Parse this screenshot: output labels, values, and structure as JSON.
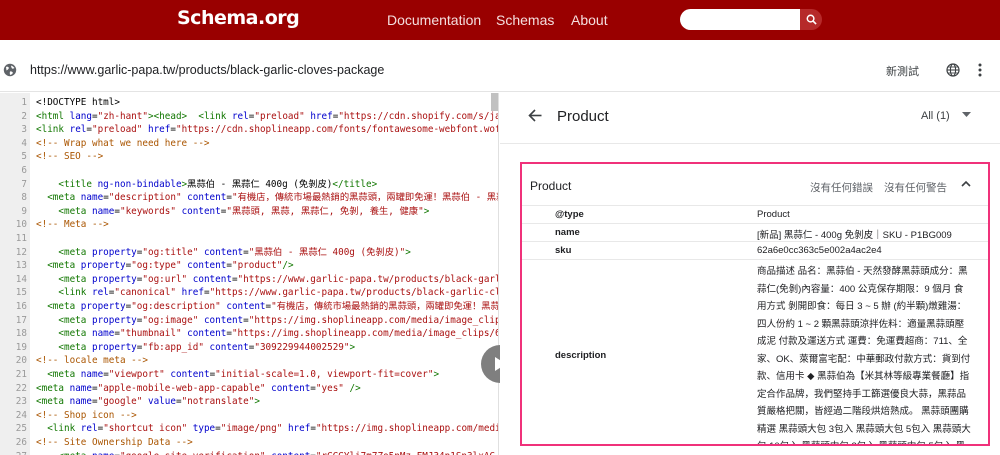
{
  "header": {
    "logo": "Schema.org",
    "nav": [
      "Documentation",
      "Schemas",
      "About"
    ],
    "search_placeholder": ""
  },
  "urlbar": {
    "url": "https://www.garlic-papa.tw/products/black-garlic-cloves-package",
    "new_test": "新測試"
  },
  "code": {
    "lines": [
      {
        "n": "1",
        "parts": [
          [
            "txt",
            "<!DOCTYPE html>"
          ]
        ]
      },
      {
        "n": "2",
        "parts": [
          [
            "tag",
            "<html "
          ],
          [
            "attr",
            "lang"
          ],
          [
            "txt",
            "="
          ],
          [
            "str",
            "\"zh-hant\""
          ],
          [
            "tag",
            "><head>  <link "
          ],
          [
            "attr",
            "rel"
          ],
          [
            "txt",
            "="
          ],
          [
            "str",
            "\"preload\" "
          ],
          [
            "attr",
            "href"
          ],
          [
            "txt",
            "="
          ],
          [
            "str",
            "\"https://cdn.shopify.com/s/jav"
          ]
        ]
      },
      {
        "n": "3",
        "parts": [
          [
            "tag",
            "<link "
          ],
          [
            "attr",
            "rel"
          ],
          [
            "txt",
            "="
          ],
          [
            "str",
            "\"preload\" "
          ],
          [
            "attr",
            "href"
          ],
          [
            "txt",
            "="
          ],
          [
            "str",
            "\"https://cdn.shoplineapp.com/fonts/fontawesome-webfont.woff"
          ]
        ]
      },
      {
        "n": "4",
        "parts": [
          [
            "com",
            "<!-- Wrap what we need here -->"
          ]
        ]
      },
      {
        "n": "5",
        "parts": [
          [
            "com",
            "<!-- SEO -->"
          ]
        ]
      },
      {
        "n": "6",
        "parts": [
          [
            "txt",
            ""
          ]
        ]
      },
      {
        "n": "7",
        "parts": [
          [
            "txt",
            "    "
          ],
          [
            "tag",
            "<title "
          ],
          [
            "attr",
            "ng-non-bindable"
          ],
          [
            "tag",
            ">"
          ],
          [
            "txt",
            "黑蒜伯 - 黑蒜仁 400g (免剝皮)"
          ],
          [
            "tag",
            "</title>"
          ]
        ]
      },
      {
        "n": "8",
        "parts": [
          [
            "txt",
            "  "
          ],
          [
            "tag",
            "<meta "
          ],
          [
            "attr",
            "name"
          ],
          [
            "txt",
            "="
          ],
          [
            "str",
            "\"description\" "
          ],
          [
            "attr",
            "content"
          ],
          [
            "txt",
            "="
          ],
          [
            "str",
            "\"有機店，傳統市場最熱銷的黑蒜頭，兩罐即免運！黑蒜伯 - 黑蒜"
          ]
        ]
      },
      {
        "n": "9",
        "parts": [
          [
            "txt",
            "    "
          ],
          [
            "tag",
            "<meta "
          ],
          [
            "attr",
            "name"
          ],
          [
            "txt",
            "="
          ],
          [
            "str",
            "\"keywords\" "
          ],
          [
            "attr",
            "content"
          ],
          [
            "txt",
            "="
          ],
          [
            "str",
            "\"黑蒜頭, 黑蒜, 黑蒜仁, 免剝, 養生, 健康\""
          ],
          [
            "tag",
            ">"
          ]
        ]
      },
      {
        "n": "10",
        "parts": [
          [
            "com",
            "<!-- Meta -->"
          ]
        ]
      },
      {
        "n": "11",
        "parts": [
          [
            "txt",
            ""
          ]
        ]
      },
      {
        "n": "12",
        "parts": [
          [
            "txt",
            "    "
          ],
          [
            "tag",
            "<meta "
          ],
          [
            "attr",
            "property"
          ],
          [
            "txt",
            "="
          ],
          [
            "str",
            "\"og:title\" "
          ],
          [
            "attr",
            "content"
          ],
          [
            "txt",
            "="
          ],
          [
            "str",
            "\"黑蒜伯 - 黑蒜仁 400g (免剝皮)\""
          ],
          [
            "tag",
            ">"
          ]
        ]
      },
      {
        "n": "13",
        "parts": [
          [
            "txt",
            "  "
          ],
          [
            "tag",
            "<meta "
          ],
          [
            "attr",
            "property"
          ],
          [
            "txt",
            "="
          ],
          [
            "str",
            "\"og:type\" "
          ],
          [
            "attr",
            "content"
          ],
          [
            "txt",
            "="
          ],
          [
            "str",
            "\"product\""
          ],
          [
            "tag",
            "/>"
          ]
        ]
      },
      {
        "n": "14",
        "parts": [
          [
            "txt",
            "    "
          ],
          [
            "tag",
            "<meta "
          ],
          [
            "attr",
            "property"
          ],
          [
            "txt",
            "="
          ],
          [
            "str",
            "\"og:url\" "
          ],
          [
            "attr",
            "content"
          ],
          [
            "txt",
            "="
          ],
          [
            "str",
            "\"https://www.garlic-papa.tw/products/black-garli"
          ]
        ]
      },
      {
        "n": "15",
        "parts": [
          [
            "txt",
            "    "
          ],
          [
            "tag",
            "<link "
          ],
          [
            "attr",
            "rel"
          ],
          [
            "txt",
            "="
          ],
          [
            "str",
            "\"canonical\" "
          ],
          [
            "attr",
            "href"
          ],
          [
            "txt",
            "="
          ],
          [
            "str",
            "\"https://www.garlic-papa.tw/products/black-garlic-clo"
          ]
        ]
      },
      {
        "n": "16",
        "parts": [
          [
            "txt",
            "  "
          ],
          [
            "tag",
            "<meta "
          ],
          [
            "attr",
            "property"
          ],
          [
            "txt",
            "="
          ],
          [
            "str",
            "\"og:description\" "
          ],
          [
            "attr",
            "content"
          ],
          [
            "txt",
            "="
          ],
          [
            "str",
            "\"有機店，傳統市場最熱銷的黑蒜頭，兩罐即免運！黑蒜伯"
          ]
        ]
      },
      {
        "n": "17",
        "parts": [
          [
            "txt",
            "    "
          ],
          [
            "tag",
            "<meta "
          ],
          [
            "attr",
            "property"
          ],
          [
            "txt",
            "="
          ],
          [
            "str",
            "\"og:image\" "
          ],
          [
            "attr",
            "content"
          ],
          [
            "txt",
            "="
          ],
          [
            "str",
            "\"https://img.shoplineapp.com/media/image_clips"
          ]
        ]
      },
      {
        "n": "18",
        "parts": [
          [
            "txt",
            "    "
          ],
          [
            "tag",
            "<meta "
          ],
          [
            "attr",
            "name"
          ],
          [
            "txt",
            "="
          ],
          [
            "str",
            "\"thumbnail\" "
          ],
          [
            "attr",
            "content"
          ],
          [
            "txt",
            "="
          ],
          [
            "str",
            "\"https://img.shoplineapp.com/media/image_clips/62"
          ]
        ]
      },
      {
        "n": "19",
        "parts": [
          [
            "txt",
            "    "
          ],
          [
            "tag",
            "<meta "
          ],
          [
            "attr",
            "property"
          ],
          [
            "txt",
            "="
          ],
          [
            "str",
            "\"fb:app_id\" "
          ],
          [
            "attr",
            "content"
          ],
          [
            "txt",
            "="
          ],
          [
            "str",
            "\"309229944002529\""
          ],
          [
            "tag",
            ">"
          ]
        ]
      },
      {
        "n": "20",
        "parts": [
          [
            "com",
            "<!-- locale meta -->"
          ]
        ]
      },
      {
        "n": "21",
        "parts": [
          [
            "txt",
            "  "
          ],
          [
            "tag",
            "<meta "
          ],
          [
            "attr",
            "name"
          ],
          [
            "txt",
            "="
          ],
          [
            "str",
            "\"viewport\" "
          ],
          [
            "attr",
            "content"
          ],
          [
            "txt",
            "="
          ],
          [
            "str",
            "\"initial-scale=1.0, viewport-fit=cover\""
          ],
          [
            "tag",
            ">"
          ]
        ]
      },
      {
        "n": "22",
        "parts": [
          [
            "tag",
            "<meta "
          ],
          [
            "attr",
            "name"
          ],
          [
            "txt",
            "="
          ],
          [
            "str",
            "\"apple-mobile-web-app-capable\" "
          ],
          [
            "attr",
            "content"
          ],
          [
            "txt",
            "="
          ],
          [
            "str",
            "\"yes\" "
          ],
          [
            "tag",
            "/>"
          ]
        ]
      },
      {
        "n": "23",
        "parts": [
          [
            "tag",
            "<meta "
          ],
          [
            "attr",
            "name"
          ],
          [
            "txt",
            "="
          ],
          [
            "str",
            "\"google\" "
          ],
          [
            "attr",
            "value"
          ],
          [
            "txt",
            "="
          ],
          [
            "str",
            "\"notranslate\""
          ],
          [
            "tag",
            ">"
          ]
        ]
      },
      {
        "n": "24",
        "parts": [
          [
            "com",
            "<!-- Shop icon -->"
          ]
        ]
      },
      {
        "n": "25",
        "parts": [
          [
            "txt",
            "  "
          ],
          [
            "tag",
            "<link "
          ],
          [
            "attr",
            "rel"
          ],
          [
            "txt",
            "="
          ],
          [
            "str",
            "\"shortcut icon\" "
          ],
          [
            "attr",
            "type"
          ],
          [
            "txt",
            "="
          ],
          [
            "str",
            "\"image/png\" "
          ],
          [
            "attr",
            "href"
          ],
          [
            "txt",
            "="
          ],
          [
            "str",
            "\"https://img.shoplineapp.com/media"
          ]
        ]
      },
      {
        "n": "26",
        "parts": [
          [
            "com",
            "<!-- Site Ownership Data -->"
          ]
        ]
      },
      {
        "n": "27",
        "parts": [
          [
            "txt",
            "    "
          ],
          [
            "tag",
            "<meta "
          ],
          [
            "attr",
            "name"
          ],
          [
            "txt",
            "="
          ],
          [
            "str",
            "\"google-site-verification\" "
          ],
          [
            "attr",
            "content"
          ],
          [
            "txt",
            "="
          ],
          [
            "str",
            "\"rGGGYli7m7Zo5nMz_FMJ34p1Sp3lxAC"
          ]
        ]
      }
    ]
  },
  "result": {
    "title": "Product",
    "filter": "All (1)",
    "card": {
      "title": "Product",
      "no_errors": "沒有任何錯誤",
      "no_warnings": "沒有任何警告",
      "rows": [
        {
          "key": "@type",
          "value": "Product"
        },
        {
          "key": "name",
          "value": "[新品] 黑蒜仁 - 400g 免剝皮｜SKU - P1BG009"
        },
        {
          "key": "sku",
          "value": "62a6e0cc363c5e002a4ac2e4"
        }
      ],
      "description_key": "description",
      "description_value": "商品描述 品名：黑蒜伯 - 天然發酵黑蒜頭成分：黑蒜仁(免剝)內容量：400 公克保存期限：9 個月 食用方式 剝開即食：每日 3 ~ 5 辦 (約半顆)燉雞湯：四人份約 1 ~ 2 顆黑蒜頭涼拌佐料：適量黑蒜頭壓成泥 付款及運送方式 運費：免運費超商：711、全家、OK、萊爾富宅配：中華郵政付款方式：貨到付款、信用卡 ◆ 黑蒜伯為【米其林等級專業餐廳】指定合作品牌，我們堅持手工篩選優良大蒜，黑蒜品質嚴格把關，皆經過二階段烘焙熟成。 黑蒜頭團購精選 黑蒜頭大包 3包入 黑蒜頭大包 5包入 黑蒜頭大包 10包入 黑蒜頭中包 3包入 黑蒜頭中包 5包入 黑蒜頭中"
    }
  }
}
